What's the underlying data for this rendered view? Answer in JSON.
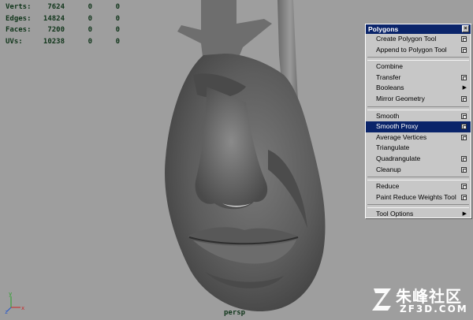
{
  "hud": {
    "rows": [
      {
        "label": "Verts:",
        "v1": "7624",
        "v2": "0",
        "v3": "0"
      },
      {
        "label": "Edges:",
        "v1": "14824",
        "v2": "0",
        "v3": "0"
      },
      {
        "label": "Faces:",
        "v1": "7200",
        "v2": "0",
        "v3": "0"
      },
      {
        "label": "UVs:",
        "v1": "10238",
        "v2": "0",
        "v3": "0"
      }
    ]
  },
  "camera_label": "persp",
  "axis": {
    "x": "x",
    "y": "y",
    "z": "z"
  },
  "menu": {
    "title": "Polygons",
    "close_icon": "close-icon",
    "groups": [
      [
        {
          "label": "Create Polygon Tool",
          "option": true
        },
        {
          "label": "Append to Polygon Tool",
          "option": true
        }
      ],
      [
        {
          "label": "Combine"
        },
        {
          "label": "Transfer",
          "option": true
        },
        {
          "label": "Booleans",
          "submenu": true
        },
        {
          "label": "Mirror Geometry",
          "option": true
        }
      ],
      [
        {
          "label": "Smooth",
          "option": true
        },
        {
          "label": "Smooth Proxy",
          "option": true,
          "highlighted": true
        },
        {
          "label": "Average Vertices",
          "option": true
        },
        {
          "label": "Triangulate"
        },
        {
          "label": "Quadrangulate",
          "option": true
        },
        {
          "label": "Cleanup",
          "option": true
        }
      ],
      [
        {
          "label": "Reduce",
          "option": true
        },
        {
          "label": "Paint Reduce Weights Tool",
          "option": true
        }
      ],
      [
        {
          "label": "Tool Options",
          "submenu": true
        }
      ]
    ]
  },
  "watermark": {
    "cn": "朱峰社区",
    "en": "ZF3D.COM"
  },
  "colors": {
    "viewport": "#9e9e9e",
    "hud_text": "#10351a",
    "menu_bg": "#c7c7c7",
    "menu_highlight": "#0a246a"
  }
}
